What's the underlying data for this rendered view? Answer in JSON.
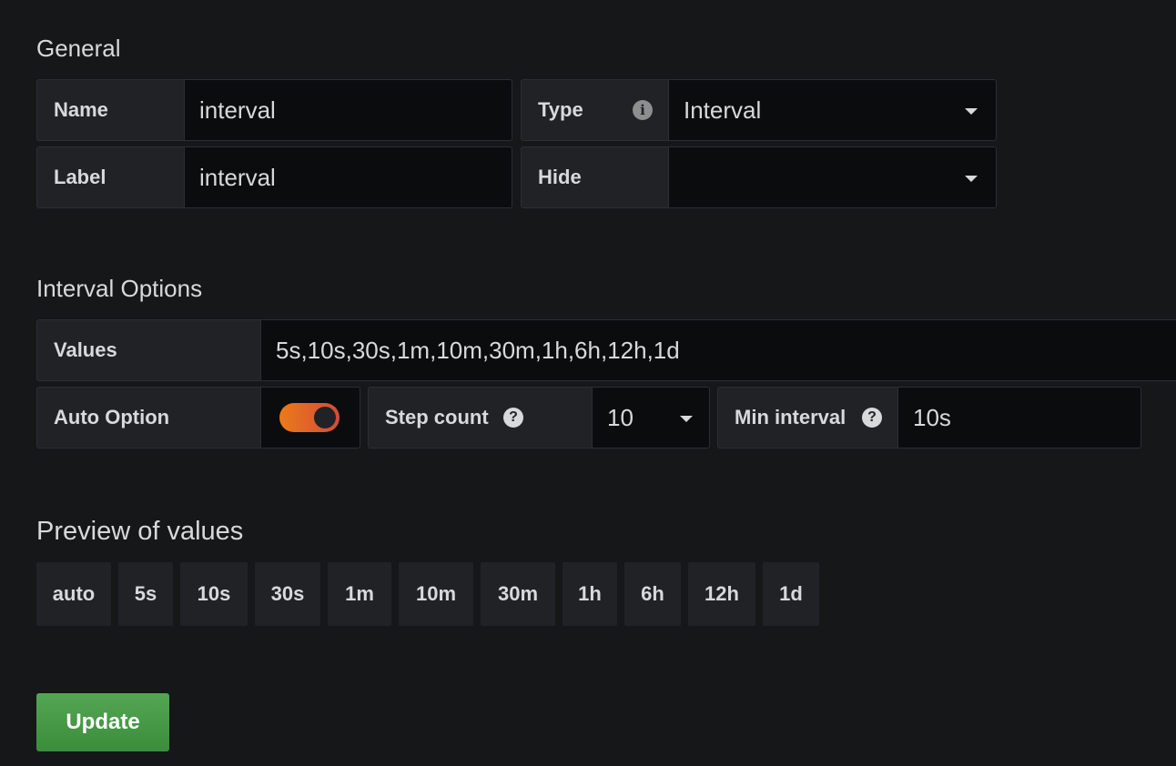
{
  "general": {
    "title": "General",
    "name_label": "Name",
    "name_value": "interval",
    "type_label": "Type",
    "type_value": "Interval",
    "label_label": "Label",
    "label_value": "interval",
    "hide_label": "Hide",
    "hide_value": ""
  },
  "interval_options": {
    "title": "Interval Options",
    "values_label": "Values",
    "values_value": "5s,10s,30s,1m,10m,30m,1h,6h,12h,1d",
    "auto_option_label": "Auto Option",
    "auto_option_enabled": true,
    "step_count_label": "Step count",
    "step_count_value": "10",
    "min_interval_label": "Min interval",
    "min_interval_value": "10s"
  },
  "preview": {
    "title": "Preview of values",
    "chips": [
      "auto",
      "5s",
      "10s",
      "30s",
      "1m",
      "10m",
      "30m",
      "1h",
      "6h",
      "12h",
      "1d"
    ]
  },
  "actions": {
    "update_label": "Update"
  },
  "colors": {
    "background": "#161719",
    "label_bg": "#202226",
    "field_bg": "#0b0c0e",
    "toggle_on": "#eb7b18",
    "update_button": "#3f9a3f"
  }
}
